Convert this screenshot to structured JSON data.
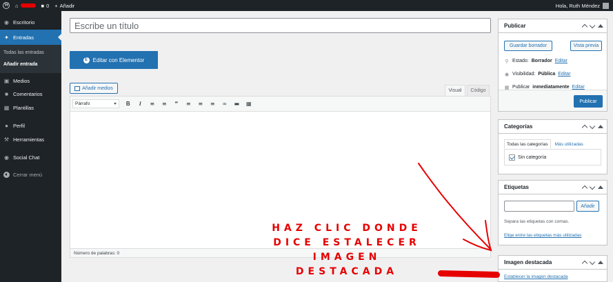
{
  "adminbar": {
    "comments_count": "0",
    "new_label": "Añadir",
    "greeting": "Hola, Ruth Méndez"
  },
  "sidebar": {
    "items": [
      {
        "label": "Escritorio",
        "icon": "dashboard-icon"
      },
      {
        "label": "Entradas",
        "icon": "pin-icon",
        "active": true
      },
      {
        "label": "Medios",
        "icon": "media-icon"
      },
      {
        "label": "Comentarios",
        "icon": "comment-icon"
      },
      {
        "label": "Plantillas",
        "icon": "folder-icon"
      },
      {
        "label": "Perfil",
        "icon": "user-icon"
      },
      {
        "label": "Herramientas",
        "icon": "wrench-icon"
      },
      {
        "label": "Social Chat",
        "icon": "chat-icon"
      }
    ],
    "submenu": [
      "Todas las entradas",
      "Añadir entrada"
    ],
    "collapse_label": "Cerrar menú"
  },
  "editor": {
    "title_placeholder": "Escribe un título",
    "elementor_button": "Editar con Elementor",
    "add_media": "Añadir medios",
    "tab_visual": "Visual",
    "tab_code": "Código",
    "format_select": "Párrafo",
    "word_count": "Número de palabras: 0"
  },
  "publish_box": {
    "title": "Publicar",
    "save_draft": "Guardar borrador",
    "preview": "Vista previa",
    "status_label": "Estado:",
    "status_value": "Borrador",
    "visibility_label": "Visibilidad:",
    "visibility_value": "Pública",
    "publish_label": "Publicar",
    "publish_value": "inmediatamente",
    "edit": "Editar",
    "publish_button": "Publicar"
  },
  "categories_box": {
    "title": "Categorías",
    "tab_all": "Todas las categorías",
    "tab_most_used": "Más utilizadas",
    "category": "Sin categoría"
  },
  "tags_box": {
    "title": "Etiquetas",
    "add_button": "Añadir",
    "note": "Separa las etiquetas con comas.",
    "choose_link": "Elige entre las etiquetas más utilizadas"
  },
  "featured_box": {
    "title": "Imagen destacada",
    "set_link": "Establecer la imagen destacada"
  },
  "annotation": {
    "line1": "HAZ CLIC DONDE",
    "line2": "DICE ESTALECER",
    "line3": "IMAGEN",
    "line4": "DESTACADA"
  },
  "colors": {
    "admin_dark": "#1d2327",
    "accent": "#2271b1",
    "annotation_red": "#e60000"
  }
}
